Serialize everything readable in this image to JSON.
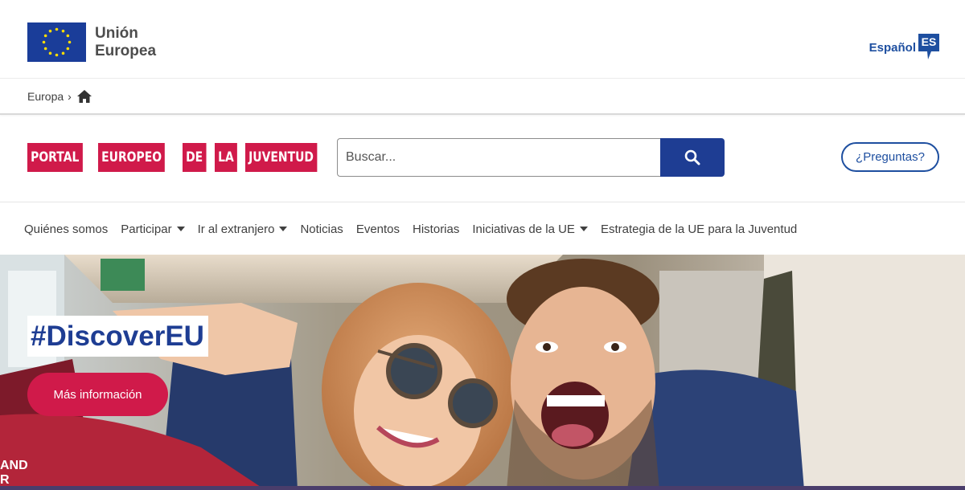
{
  "eu_header": {
    "logo_line1": "Unión",
    "logo_line2": "Europea",
    "language_label": "Español",
    "language_code": "ES"
  },
  "breadcrumb": {
    "items": [
      "Europa"
    ],
    "home_icon": "home-icon"
  },
  "portal": {
    "logo_words": [
      "PORTAL",
      "EUROPEO",
      "DE",
      "LA",
      "JUVENTUD"
    ],
    "search_placeholder": "Buscar...",
    "search_icon": "search-icon",
    "questions_label": "¿Preguntas?"
  },
  "nav": {
    "items": [
      {
        "label": "Quiénes somos",
        "dropdown": false
      },
      {
        "label": "Participar",
        "dropdown": true
      },
      {
        "label": "Ir al extranjero",
        "dropdown": true
      },
      {
        "label": "Noticias",
        "dropdown": false
      },
      {
        "label": "Eventos",
        "dropdown": false
      },
      {
        "label": "Historias",
        "dropdown": false
      },
      {
        "label": "Iniciativas de la UE",
        "dropdown": true
      },
      {
        "label": "Estrategia de la UE para la Juventud",
        "dropdown": false
      }
    ]
  },
  "hero": {
    "tag": "#DiscoverEU",
    "button_label": "Más información",
    "corner_text_line1": "AND",
    "corner_text_line2": "R"
  },
  "colors": {
    "eu_blue": "#1a3d99",
    "portal_red": "#d01a4a",
    "link_blue": "#1e4fa0",
    "search_button": "#1e3d93"
  }
}
